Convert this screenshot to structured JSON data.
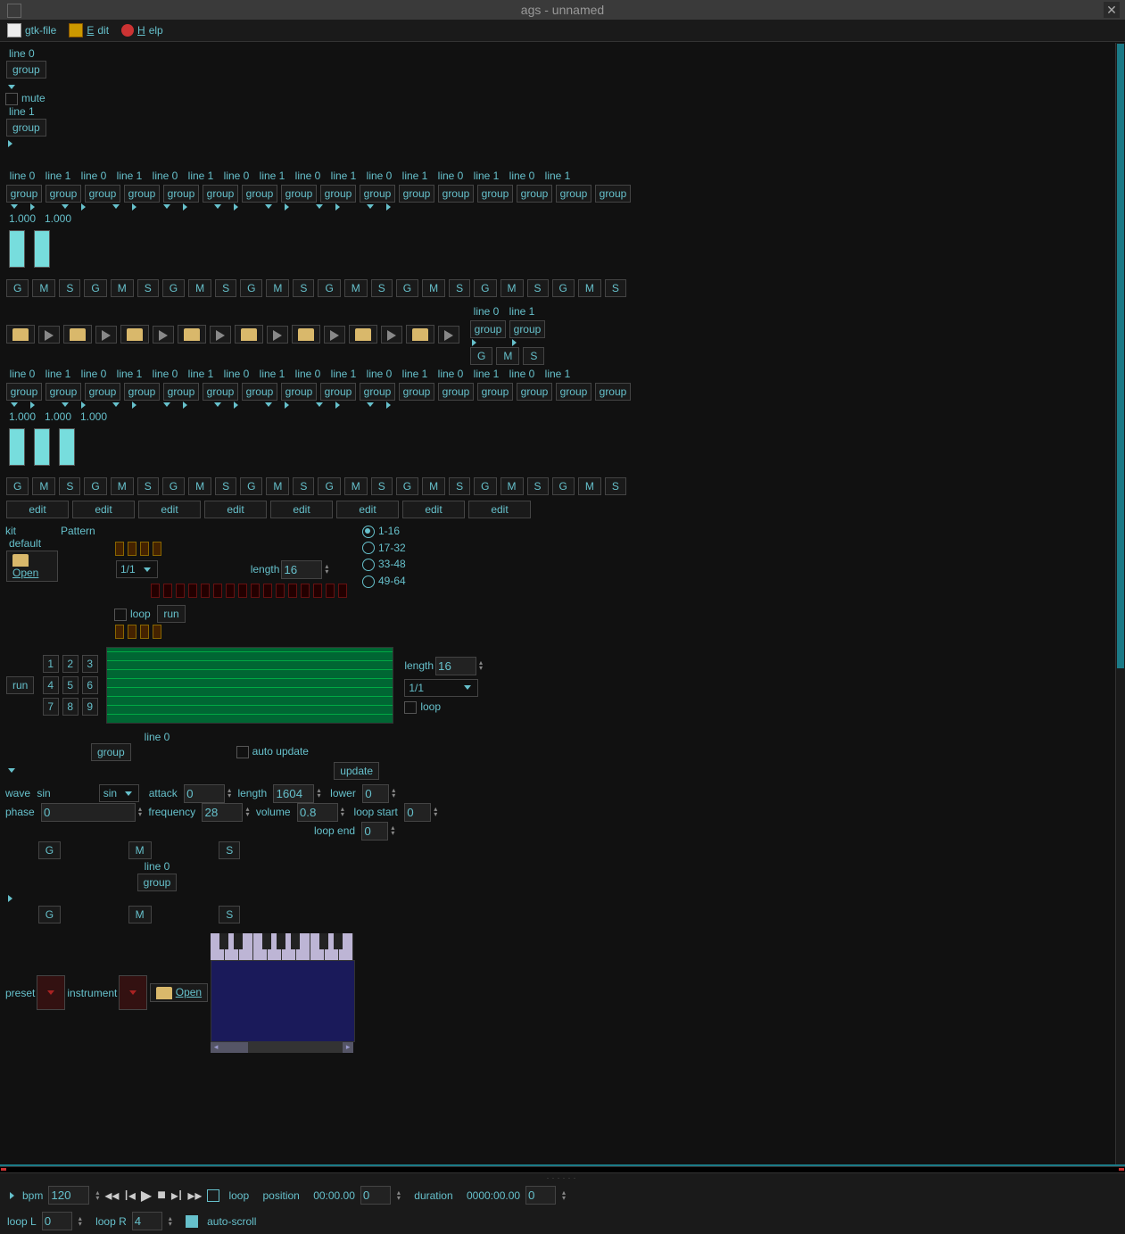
{
  "title": "ags - unnamed",
  "menu": {
    "file": "gtk-file",
    "edit": "Edit",
    "help": "Help"
  },
  "top": {
    "line0": "line 0",
    "line1": "line 1",
    "group": "group",
    "mute": "mute"
  },
  "chan": {
    "line0": "line 0",
    "line1": "line 1",
    "group": "group",
    "val": "1.000",
    "G": "G",
    "M": "M",
    "S": "S",
    "edit": "edit"
  },
  "pattern": {
    "kit": "kit",
    "default": "default",
    "open": "Open",
    "label": "Pattern",
    "loop": "loop",
    "run": "run",
    "time": "1/1",
    "length_lbl": "length",
    "length": "16",
    "ranges": [
      "1-16",
      "17-32",
      "33-48",
      "49-64"
    ]
  },
  "seq": {
    "run": "run",
    "nums": [
      "1",
      "2",
      "3",
      "4",
      "5",
      "6",
      "7",
      "8",
      "9"
    ],
    "length_lbl": "length",
    "length": "16",
    "time": "1/1",
    "loop": "loop"
  },
  "synth": {
    "line0": "line 0",
    "group": "group",
    "auto_update": "auto update",
    "update": "update",
    "wave": "wave",
    "wave_val": "sin",
    "sin": "sin",
    "attack": "attack",
    "attack_val": "0",
    "length_lbl": "length",
    "length_val": "1604",
    "phase": "phase",
    "phase_val": "0",
    "frequency": "frequency",
    "frequency_val": "28",
    "volume": "volume",
    "volume_val": "0.8",
    "lower": "lower",
    "lower_val": "0",
    "loop_start": "loop start",
    "loop_start_val": "0",
    "loop_end": "loop end",
    "loop_end_val": "0",
    "G": "G",
    "M": "M",
    "S": "S"
  },
  "sampler": {
    "preset": "preset",
    "instrument": "instrument",
    "open": "Open"
  },
  "transport": {
    "bpm_lbl": "bpm",
    "bpm": "120",
    "loop": "loop",
    "pos_lbl": "position",
    "pos": "00:00.00",
    "pos_n": "0",
    "dur_lbl": "duration",
    "dur": "0000:00.00",
    "dur_n": "0",
    "loopL_lbl": "loop L",
    "loopL": "0",
    "loopR_lbl": "loop R",
    "loopR": "4",
    "autoscroll": "auto-scroll"
  }
}
